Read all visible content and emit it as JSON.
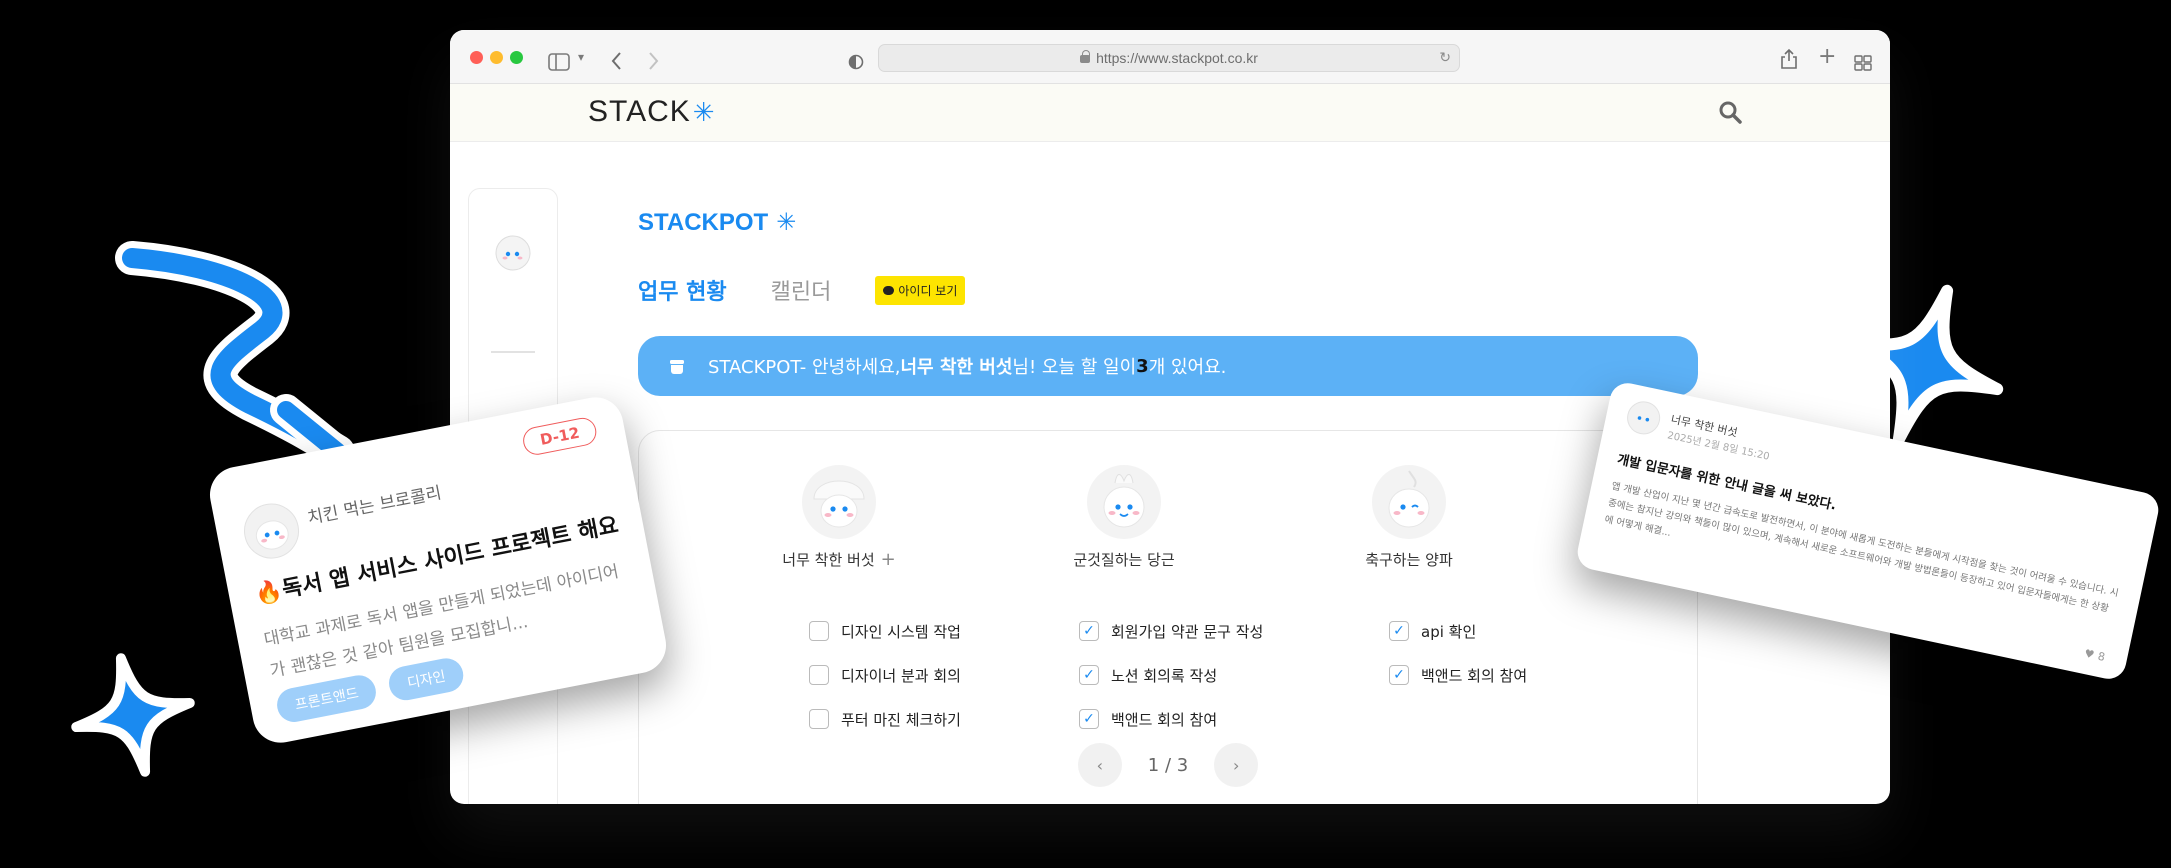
{
  "browser": {
    "url": "https://www.stackpot.co.kr"
  },
  "site": {
    "logo": "STACK",
    "logo_mark": "✳"
  },
  "main": {
    "brand_title": "STACKPOT",
    "brand_mark": "✳",
    "tabs": [
      {
        "label": "업무 현황",
        "active": true
      },
      {
        "label": "캘린더",
        "active": false
      }
    ],
    "id_badge": "아이디 보기",
    "banner": {
      "prefix": "STACKPOT- 안녕하세요, ",
      "name": "너무 착한 버섯",
      "middle": " 님! 오늘 할 일이 ",
      "count": "3",
      "suffix": "개 있어요."
    },
    "members": [
      {
        "name": "너무 착한 버섯",
        "show_plus": true,
        "plus": "+",
        "tasks": [
          {
            "label": "디자인 시스템 작업",
            "done": false
          },
          {
            "label": "디자이너 분과 회의",
            "done": false
          },
          {
            "label": "푸터 마진 체크하기",
            "done": false
          }
        ]
      },
      {
        "name": "군것질하는 당근",
        "show_plus": false,
        "plus": "",
        "tasks": [
          {
            "label": "회원가입 약관 문구 작성",
            "done": true
          },
          {
            "label": "노션 회의록 작성",
            "done": true
          },
          {
            "label": "백앤드 회의 참여",
            "done": true
          }
        ]
      },
      {
        "name": "축구하는 양파",
        "show_plus": false,
        "plus": "",
        "tasks": [
          {
            "label": "api 확인",
            "done": true
          },
          {
            "label": "백앤드 회의 참여",
            "done": true
          }
        ]
      }
    ],
    "pager": {
      "text": "1 / 3",
      "prev": "‹",
      "next": "›"
    }
  },
  "card_left": {
    "author": "치킨 먹는 브로콜리",
    "dday": "D-12",
    "title": "🔥독서 앱 서비스 사이드 프로젝트 해요",
    "desc": "대학교 과제로 독서 앱을 만들게 되었는데 아이디어가 괜찮은 것 같아 팀원을 모집합니...",
    "tags": [
      "프론트앤드",
      "디자인"
    ]
  },
  "card_right": {
    "author": "너무 착한 버섯",
    "date": "2025년 2월 8일 15:20",
    "title": "개발 입문자를 위한 안내 글을 써 보았다.",
    "body": "앱 개발 산업이 지난 몇 년간 급속도로 발전하면서, 이 분야에 새롭게 도전하는 분들에게 시작점을 찾는 것이 어려울 수 있습니다. 시중에는 참지난 강의와 책들이 많이 있으며, 계속해서 새로운 소프트웨어와 개발 방법론들이 등장하고 있어 입문자들에게는 한 상황에 어떻게 해결...",
    "likes": "8"
  },
  "colors": {
    "accent": "#1a8af0",
    "banner": "#5cb1f6",
    "badge": "#fde400",
    "dday": "#f05c5c",
    "tag": "#9fcffa",
    "arrow": "#1a8af0"
  },
  "icons": {
    "search": "search-icon",
    "back": "chevron-left-icon",
    "forward": "chevron-right-icon",
    "sidebar": "sidebar-icon",
    "share": "share-icon",
    "new_tab": "plus-icon",
    "tabs": "tab-overview-icon",
    "shield": "shield-icon",
    "lock": "lock-icon",
    "reload": "reload-icon",
    "heart": "heart-icon",
    "pot": "pot-icon",
    "chat": "chat-bubble-icon",
    "check": "check-icon"
  }
}
